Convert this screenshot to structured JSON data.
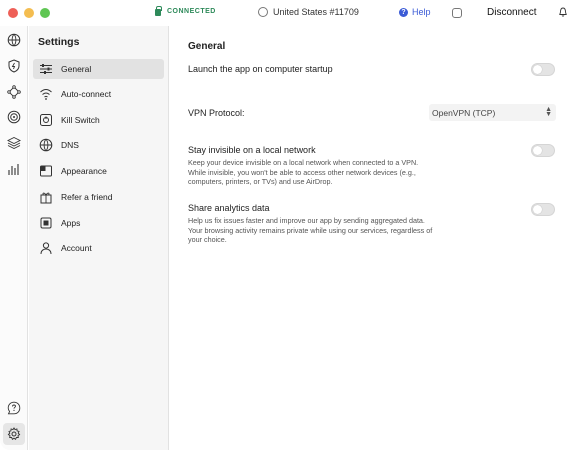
{
  "titlebar": {
    "status": "CONNECTED",
    "server": "United States #11709",
    "help": "Help",
    "disconnect": "Disconnect"
  },
  "rail": {
    "icons": [
      "globe-icon",
      "shield-icon",
      "mesh-icon",
      "target-icon",
      "layers-icon",
      "stats-icon",
      "help-icon",
      "settings-icon"
    ]
  },
  "sidebar": {
    "title": "Settings",
    "items": [
      {
        "label": "General",
        "icon": "sliders-icon"
      },
      {
        "label": "Auto-connect",
        "icon": "wifi-icon"
      },
      {
        "label": "Kill Switch",
        "icon": "kill-switch-icon"
      },
      {
        "label": "DNS",
        "icon": "dns-globe-icon"
      },
      {
        "label": "Appearance",
        "icon": "appearance-icon"
      },
      {
        "label": "Refer a friend",
        "icon": "gift-icon"
      },
      {
        "label": "Apps",
        "icon": "apps-icon"
      },
      {
        "label": "Account",
        "icon": "account-icon"
      }
    ]
  },
  "main": {
    "title": "General",
    "startup": {
      "label": "Launch the app on computer startup",
      "enabled": false
    },
    "protocol": {
      "label": "VPN Protocol:",
      "value": "OpenVPN (TCP)"
    },
    "invisible": {
      "label": "Stay invisible on a local network",
      "description": "Keep your device invisible on a local network when connected to a VPN. While invisible, you won't be able to access other network devices (e.g., computers, printers, or TVs) and use AirDrop.",
      "enabled": false
    },
    "analytics": {
      "label": "Share analytics data",
      "description": "Help us fix issues faster and improve our app by sending aggregated data. Your browsing activity remains private while using our services, regardless of your choice.",
      "enabled": false
    }
  },
  "colors": {
    "connected": "#2e8a5a",
    "help": "#3b5bd6",
    "sidebar_bg": "#f6f6f6",
    "active_item": "#e2e2e2"
  }
}
